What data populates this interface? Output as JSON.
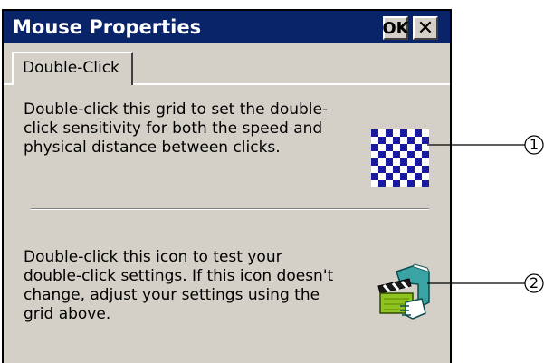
{
  "window": {
    "title": "Mouse Properties",
    "ok_label": "OK",
    "close_glyph": "✕"
  },
  "tabs": [
    {
      "label": "Double-Click",
      "selected": true
    }
  ],
  "content": {
    "grid_text": "Double-click this grid to set the double-\nclick sensitivity for both the speed and\nphysical distance between clicks.",
    "test_text": "Double-click this icon to test your\ndouble-click settings. If this icon doesn't\nchange, adjust your settings using the\ngrid above.",
    "grid_icon": "checkerboard-grid-icon",
    "test_icon": "clapperboard-hands-icon"
  },
  "callouts": [
    {
      "label": "1",
      "target": "grid_icon"
    },
    {
      "label": "2",
      "target": "test_icon"
    }
  ],
  "colors": {
    "titlebar": "#0a246a",
    "dialog_face": "#d4d0c8",
    "grid_blue": "#1a1aa0",
    "icon_green": "#8fc31f",
    "icon_teal": "#3aa3a3"
  }
}
